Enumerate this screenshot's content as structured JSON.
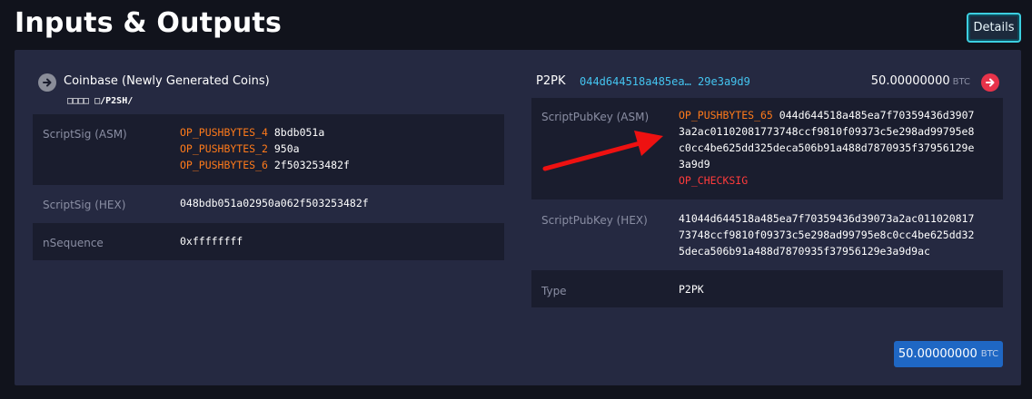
{
  "page": {
    "title": "Inputs & Outputs",
    "details_label": "Details"
  },
  "colors": {
    "accent": "#3ccfe0",
    "op_orange": "#ff7a1a",
    "op_red": "#ff3b3b",
    "link": "#44c4f0",
    "badge": "#1f67c4"
  },
  "input": {
    "icon": "arrow-right-circle-icon",
    "title": "Coinbase (Newly Generated Coins)",
    "subtitle": "□□□□ □/P2SH/",
    "rows": {
      "scriptsig_asm_label": "ScriptSig (ASM)",
      "scriptsig_asm": [
        {
          "op": "OP_PUSHBYTES_4",
          "arg": "8bdb051a"
        },
        {
          "op": "OP_PUSHBYTES_2",
          "arg": "950a"
        },
        {
          "op": "OP_PUSHBYTES_6",
          "arg": "2f503253482f"
        }
      ],
      "scriptsig_hex_label": "ScriptSig (HEX)",
      "scriptsig_hex": "048bdb051a02950a062f503253482f",
      "nsequence_label": "nSequence",
      "nsequence": "0xffffffff"
    }
  },
  "output": {
    "type_label": "P2PK",
    "address": "044d644518a485ea… 29e3a9d9",
    "value": "50.00000000",
    "unit": "BTC",
    "icon": "arrow-right-circle-red-icon",
    "rows": {
      "scriptpubkey_asm_label": "ScriptPubKey (ASM)",
      "asm_op1": "OP_PUSHBYTES_65",
      "asm_line1": "044d644518a485ea7f70359436d3907",
      "asm_line2": "3a2ac01102081773748ccf9810f09373c5e298ad99795e8",
      "asm_line3": "c0cc4be625dd325deca506b91a488d7870935f37956129e",
      "asm_line4": "3a9d9",
      "asm_op2": "OP_CHECKSIG",
      "scriptpubkey_hex_label": "ScriptPubKey (HEX)",
      "hex_line1": "41044d644518a485ea7f70359436d39073a2ac011020817",
      "hex_line2": "73748ccf9810f09373c5e298ad99795e8c0cc4be625dd32",
      "hex_line3": "5deca506b91a488d7870935f37956129e3a9d9ac",
      "type_label": "Type",
      "type_value": "P2PK"
    }
  },
  "total": {
    "value": "50.00000000",
    "unit": "BTC"
  }
}
